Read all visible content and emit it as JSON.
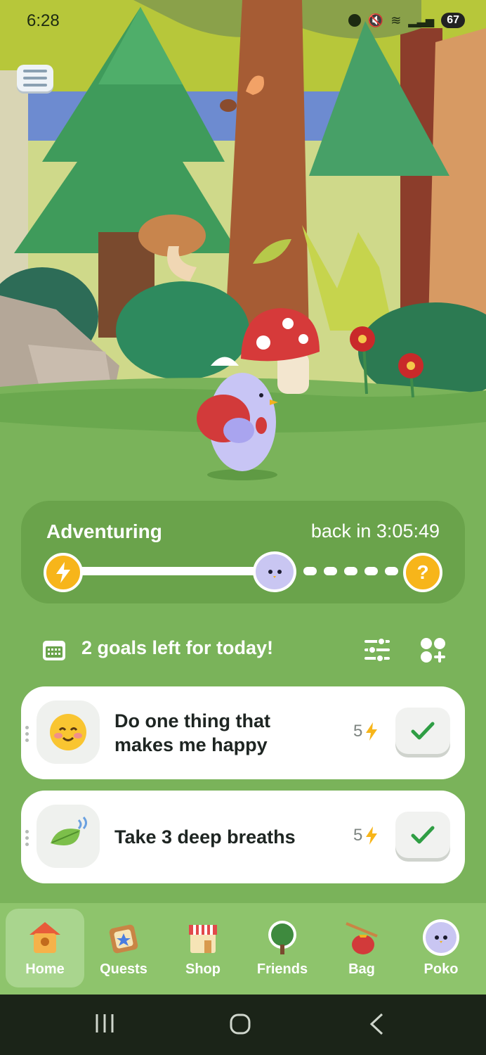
{
  "status_bar": {
    "time": "6:28",
    "battery": "67"
  },
  "adventure": {
    "status": "Adventuring",
    "back_in": "back in 3:05:49",
    "unknown_marker": "?"
  },
  "goals": {
    "header": "2 goals left for today!",
    "items": [
      {
        "title": "Do one thing that makes me happy",
        "points": "5",
        "icon": "smiling-face-icon"
      },
      {
        "title": "Take 3 deep breaths",
        "points": "5",
        "icon": "leaf-breath-icon"
      }
    ]
  },
  "nav": {
    "items": [
      {
        "label": "Home",
        "icon": "birdhouse-icon",
        "active": true
      },
      {
        "label": "Quests",
        "icon": "quest-board-icon"
      },
      {
        "label": "Shop",
        "icon": "shop-icon"
      },
      {
        "label": "Friends",
        "icon": "tree-icon"
      },
      {
        "label": "Bag",
        "icon": "bag-icon"
      },
      {
        "label": "Poko",
        "icon": "poko-icon"
      }
    ]
  },
  "colors": {
    "grass": "#7ab35a",
    "accent": "#f7b51a",
    "check": "#2f9e44"
  }
}
